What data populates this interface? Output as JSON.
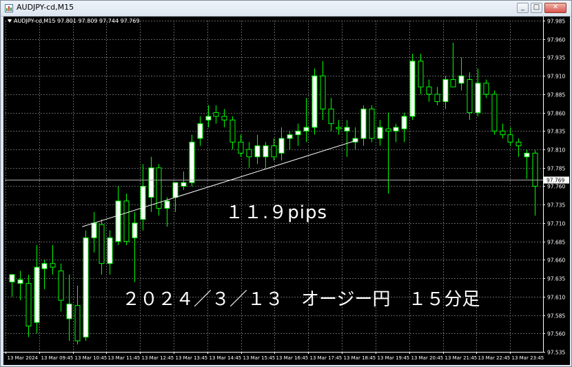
{
  "window": {
    "title": "AUDJPY-cd,M15",
    "minimize_label": "_",
    "maximize_label": "□",
    "close_label": "✕"
  },
  "chart_header": "AUDJPY-cd,M15  97.801 97.809 97.744 97.769",
  "colors": {
    "background": "#000000",
    "grid": "#646464",
    "bull_body": "#ffffff",
    "bear_body": "#000000",
    "candle_outline": "#00ff00",
    "axis_text": "#ffffff",
    "annotation": "#ffffff"
  },
  "annotations": {
    "pips": "１１.９pips",
    "caption": "２０２４／３／１３　オージー円　１５分足"
  },
  "chart_data": {
    "type": "candlestick",
    "symbol": "AUDJPY-cd",
    "timeframe": "M15",
    "ylim": [
      97.535,
      97.985
    ],
    "y_ticks": [
      97.535,
      97.56,
      97.585,
      97.61,
      97.635,
      97.66,
      97.685,
      97.71,
      97.735,
      97.76,
      97.785,
      97.81,
      97.835,
      97.86,
      97.885,
      97.91,
      97.935,
      97.96,
      97.985
    ],
    "x_ticks": [
      "13 Mar 2024",
      "13 Mar 09:45",
      "13 Mar 10:45",
      "13 Mar 11:45",
      "13 Mar 12:45",
      "13 Mar 13:45",
      "13 Mar 14:45",
      "13 Mar 15:45",
      "13 Mar 16:45",
      "13 Mar 17:45",
      "13 Mar 18:45",
      "13 Mar 19:45",
      "13 Mar 20:45",
      "13 Mar 21:45",
      "13 Mar 22:45",
      "13 Mar 23:45"
    ],
    "current_price": "97.769",
    "trendline": {
      "from": [
        "13 Mar 10:45",
        97.705
      ],
      "to": [
        "13 Mar 18:45",
        97.823
      ],
      "label": "１１.９pips"
    },
    "candles": [
      {
        "o": 97.63,
        "h": 97.64,
        "l": 97.61,
        "c": 97.64
      },
      {
        "o": 97.628,
        "h": 97.645,
        "l": 97.605,
        "c": 97.633
      },
      {
        "o": 97.628,
        "h": 97.64,
        "l": 97.555,
        "c": 97.57
      },
      {
        "o": 97.575,
        "h": 97.68,
        "l": 97.56,
        "c": 97.65
      },
      {
        "o": 97.648,
        "h": 97.66,
        "l": 97.62,
        "c": 97.655
      },
      {
        "o": 97.655,
        "h": 97.68,
        "l": 97.64,
        "c": 97.65
      },
      {
        "o": 97.645,
        "h": 97.655,
        "l": 97.59,
        "c": 97.605
      },
      {
        "o": 97.58,
        "h": 97.64,
        "l": 97.55,
        "c": 97.6
      },
      {
        "o": 97.598,
        "h": 97.625,
        "l": 97.545,
        "c": 97.55
      },
      {
        "o": 97.555,
        "h": 97.7,
        "l": 97.55,
        "c": 97.69
      },
      {
        "o": 97.69,
        "h": 97.725,
        "l": 97.67,
        "c": 97.71
      },
      {
        "o": 97.708,
        "h": 97.715,
        "l": 97.64,
        "c": 97.655
      },
      {
        "o": 97.655,
        "h": 97.7,
        "l": 97.64,
        "c": 97.69
      },
      {
        "o": 97.685,
        "h": 97.76,
        "l": 97.68,
        "c": 97.74
      },
      {
        "o": 97.74,
        "h": 97.75,
        "l": 97.68,
        "c": 97.685
      },
      {
        "o": 97.69,
        "h": 97.725,
        "l": 97.63,
        "c": 97.71
      },
      {
        "o": 97.715,
        "h": 97.79,
        "l": 97.7,
        "c": 97.76
      },
      {
        "o": 97.745,
        "h": 97.8,
        "l": 97.725,
        "c": 97.785
      },
      {
        "o": 97.785,
        "h": 97.79,
        "l": 97.72,
        "c": 97.73
      },
      {
        "o": 97.73,
        "h": 97.745,
        "l": 97.705,
        "c": 97.74
      },
      {
        "o": 97.745,
        "h": 97.76,
        "l": 97.725,
        "c": 97.765
      },
      {
        "o": 97.76,
        "h": 97.78,
        "l": 97.755,
        "c": 97.765
      },
      {
        "o": 97.765,
        "h": 97.83,
        "l": 97.76,
        "c": 97.82
      },
      {
        "o": 97.825,
        "h": 97.855,
        "l": 97.815,
        "c": 97.845
      },
      {
        "o": 97.85,
        "h": 97.87,
        "l": 97.84,
        "c": 97.855
      },
      {
        "o": 97.86,
        "h": 97.87,
        "l": 97.845,
        "c": 97.855
      },
      {
        "o": 97.855,
        "h": 97.865,
        "l": 97.84,
        "c": 97.85
      },
      {
        "o": 97.85,
        "h": 97.855,
        "l": 97.81,
        "c": 97.82
      },
      {
        "o": 97.82,
        "h": 97.83,
        "l": 97.8,
        "c": 97.805
      },
      {
        "o": 97.81,
        "h": 97.82,
        "l": 97.785,
        "c": 97.8
      },
      {
        "o": 97.8,
        "h": 97.83,
        "l": 97.79,
        "c": 97.815
      },
      {
        "o": 97.8,
        "h": 97.82,
        "l": 97.785,
        "c": 97.815
      },
      {
        "o": 97.815,
        "h": 97.825,
        "l": 97.795,
        "c": 97.8
      },
      {
        "o": 97.805,
        "h": 97.84,
        "l": 97.795,
        "c": 97.825
      },
      {
        "o": 97.825,
        "h": 97.835,
        "l": 97.81,
        "c": 97.83
      },
      {
        "o": 97.83,
        "h": 97.845,
        "l": 97.815,
        "c": 97.835
      },
      {
        "o": 97.835,
        "h": 97.88,
        "l": 97.82,
        "c": 97.84
      },
      {
        "o": 97.84,
        "h": 97.92,
        "l": 97.83,
        "c": 97.91
      },
      {
        "o": 97.91,
        "h": 97.93,
        "l": 97.85,
        "c": 97.865
      },
      {
        "o": 97.865,
        "h": 97.88,
        "l": 97.835,
        "c": 97.845
      },
      {
        "o": 97.84,
        "h": 97.85,
        "l": 97.83,
        "c": 97.838
      },
      {
        "o": 97.835,
        "h": 97.85,
        "l": 97.8,
        "c": 97.84
      },
      {
        "o": 97.82,
        "h": 97.84,
        "l": 97.81,
        "c": 97.825
      },
      {
        "o": 97.825,
        "h": 97.87,
        "l": 97.815,
        "c": 97.865
      },
      {
        "o": 97.865,
        "h": 97.87,
        "l": 97.82,
        "c": 97.825
      },
      {
        "o": 97.825,
        "h": 97.85,
        "l": 97.815,
        "c": 97.84
      },
      {
        "o": 97.838,
        "h": 97.86,
        "l": 97.75,
        "c": 97.835
      },
      {
        "o": 97.835,
        "h": 97.845,
        "l": 97.82,
        "c": 97.84
      },
      {
        "o": 97.838,
        "h": 97.86,
        "l": 97.82,
        "c": 97.855
      },
      {
        "o": 97.855,
        "h": 97.94,
        "l": 97.85,
        "c": 97.93
      },
      {
        "o": 97.93,
        "h": 97.94,
        "l": 97.885,
        "c": 97.895
      },
      {
        "o": 97.895,
        "h": 97.905,
        "l": 97.875,
        "c": 97.885
      },
      {
        "o": 97.885,
        "h": 97.895,
        "l": 97.87,
        "c": 97.875
      },
      {
        "o": 97.875,
        "h": 97.91,
        "l": 97.865,
        "c": 97.905
      },
      {
        "o": 97.905,
        "h": 97.955,
        "l": 97.895,
        "c": 97.895
      },
      {
        "o": 97.9,
        "h": 97.935,
        "l": 97.89,
        "c": 97.91
      },
      {
        "o": 97.905,
        "h": 97.915,
        "l": 97.85,
        "c": 97.86
      },
      {
        "o": 97.86,
        "h": 97.92,
        "l": 97.855,
        "c": 97.9
      },
      {
        "o": 97.9,
        "h": 97.905,
        "l": 97.88,
        "c": 97.885
      },
      {
        "o": 97.885,
        "h": 97.89,
        "l": 97.83,
        "c": 97.835
      },
      {
        "o": 97.835,
        "h": 97.845,
        "l": 97.825,
        "c": 97.83
      },
      {
        "o": 97.83,
        "h": 97.84,
        "l": 97.815,
        "c": 97.82
      },
      {
        "o": 97.82,
        "h": 97.825,
        "l": 97.8,
        "c": 97.815
      },
      {
        "o": 97.8,
        "h": 97.81,
        "l": 97.77,
        "c": 97.805
      },
      {
        "o": 97.805,
        "h": 97.809,
        "l": 97.72,
        "c": 97.76
      }
    ]
  }
}
